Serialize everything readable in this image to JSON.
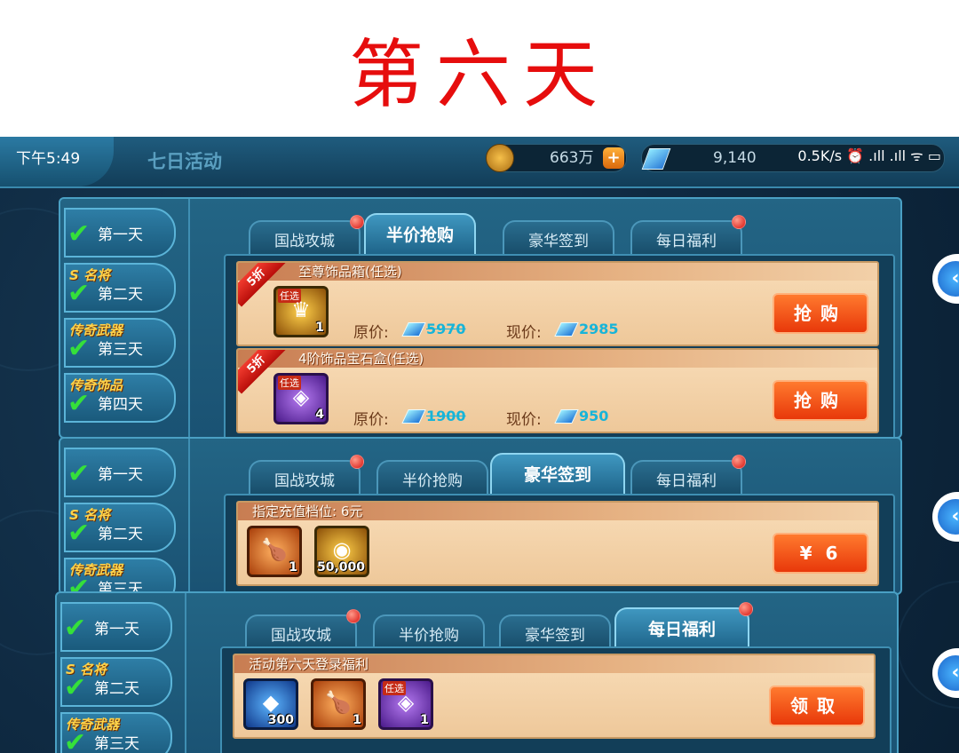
{
  "caption": "第六天",
  "status_bar": {
    "time": "下午5:49",
    "right": "0.5K/s ⏰ .ıll .ıll ᯤ ▭"
  },
  "topbar": {
    "title": "七日活动",
    "gold": "663万",
    "gems": "9,140"
  },
  "sidebar_items": [
    {
      "tag": "",
      "day": "第一天"
    },
    {
      "tag": "S 名将",
      "day": "第二天"
    },
    {
      "tag": "传奇武器",
      "day": "第三天"
    },
    {
      "tag": "传奇饰品",
      "day": "第四天"
    }
  ],
  "tabs": [
    "国战攻城",
    "半价抢购",
    "豪华签到",
    "每日福利"
  ],
  "panel1": {
    "cards": [
      {
        "ribbon": "5折",
        "title": "至尊饰品箱(任选)",
        "badge": "任选",
        "qty": "1",
        "orig_label": "原价:",
        "orig": "5970",
        "now_label": "现价:",
        "now": "2985",
        "button": "抢购"
      },
      {
        "ribbon": "5折",
        "title": "4阶饰品宝石盒(任选)",
        "badge": "任选",
        "qty": "4",
        "orig_label": "原价:",
        "orig": "1900",
        "now_label": "现价:",
        "now": "950",
        "button": "抢购"
      }
    ]
  },
  "panel2": {
    "card": {
      "title": "指定充值档位: 6元",
      "items": [
        {
          "qty": "1"
        },
        {
          "qty": "50,000"
        }
      ],
      "button": "¥ 6"
    }
  },
  "panel3": {
    "card": {
      "title": "活动第六天登录福利",
      "items": [
        {
          "qty": "300"
        },
        {
          "qty": "1"
        },
        {
          "badge": "任选",
          "qty": "1"
        }
      ],
      "button": "领取"
    }
  },
  "colors": {
    "accent": "#e60d0d",
    "button": "#e8380a",
    "check": "#35e03a"
  }
}
